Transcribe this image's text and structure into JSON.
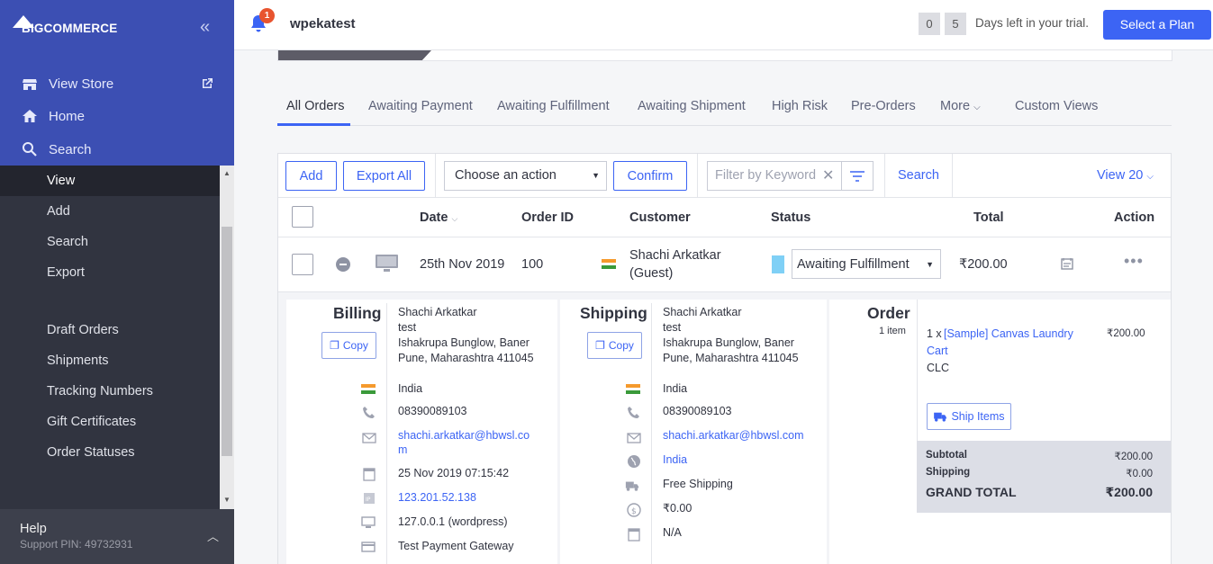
{
  "brand": {
    "logo_text": "BIGCOMMERCE"
  },
  "sidebar": {
    "top_items": [
      {
        "label": "View Store"
      },
      {
        "label": "Home"
      },
      {
        "label": "Search"
      }
    ],
    "sub_items": [
      {
        "label": "View"
      },
      {
        "label": "Add"
      },
      {
        "label": "Search"
      },
      {
        "label": "Export"
      },
      {
        "label": "Draft Orders"
      },
      {
        "label": "Shipments"
      },
      {
        "label": "Tracking Numbers"
      },
      {
        "label": "Gift Certificates"
      },
      {
        "label": "Order Statuses"
      }
    ],
    "help": {
      "label": "Help",
      "pin": "Support PIN: 49732931"
    }
  },
  "header": {
    "notification_count": "1",
    "store_name": "wpekatest",
    "trial_digits": [
      "0",
      "5"
    ],
    "trial_text": "Days left in your trial.",
    "plan_button": "Select a Plan"
  },
  "tabs": [
    {
      "label": "All Orders",
      "active": true
    },
    {
      "label": "Awaiting Payment"
    },
    {
      "label": "Awaiting Fulfillment"
    },
    {
      "label": "Awaiting Shipment"
    },
    {
      "label": "High Risk"
    },
    {
      "label": "Pre-Orders"
    },
    {
      "label": "More"
    },
    {
      "label": "Custom Views"
    }
  ],
  "toolbar": {
    "add": "Add",
    "export_all": "Export All",
    "action_select": "Choose an action",
    "confirm": "Confirm",
    "filter_placeholder": "Filter by Keyword",
    "search": "Search",
    "view_count": "View 20"
  },
  "table": {
    "headers": {
      "date": "Date",
      "order_id": "Order ID",
      "customer": "Customer",
      "status": "Status",
      "total": "Total",
      "action": "Action"
    },
    "row": {
      "date": "25th Nov 2019",
      "order_id": "100",
      "customer_name": "Shachi Arkatkar",
      "customer_type": "(Guest)",
      "status": "Awaiting Fulfillment",
      "status_color": "#7fd0f6",
      "total": "₹200.00"
    }
  },
  "billing": {
    "title": "Billing",
    "copy": "Copy",
    "name": "Shachi Arkatkar",
    "company": "test",
    "street": "Ishakrupa Bunglow, Baner",
    "city": "Pune, Maharashtra 411045",
    "country": "India",
    "phone": "08390089103",
    "email_line1": "shachi.arkatkar@hbwsl.co",
    "email_line2": "m",
    "date": "25 Nov 2019 07:15:42",
    "ip": "123.201.52.138",
    "device": "127.0.0.1 (wordpress)",
    "payment": "Test Payment Gateway"
  },
  "shipping": {
    "title": "Shipping",
    "copy": "Copy",
    "name": "Shachi Arkatkar",
    "company": "test",
    "street": "Ishakrupa Bunglow, Baner",
    "city": "Pune, Maharashtra 411045",
    "country": "India",
    "phone": "08390089103",
    "email": "shachi.arkatkar@hbwsl.com",
    "region": "India",
    "method": "Free Shipping",
    "cost": "₹0.00",
    "date": "N/A"
  },
  "order": {
    "title": "Order",
    "item_count": "1 item",
    "qty": "1 x",
    "item_line1": "[Sample] Canvas Laundry",
    "item_line2": "Cart",
    "sku": "CLC",
    "item_price": "₹200.00",
    "ship_items": "Ship Items",
    "subtotal_label": "Subtotal",
    "subtotal": "₹200.00",
    "shipping_label": "Shipping",
    "shipping": "₹0.00",
    "grand_total_label": "GRAND TOTAL",
    "grand_total": "₹200.00"
  }
}
